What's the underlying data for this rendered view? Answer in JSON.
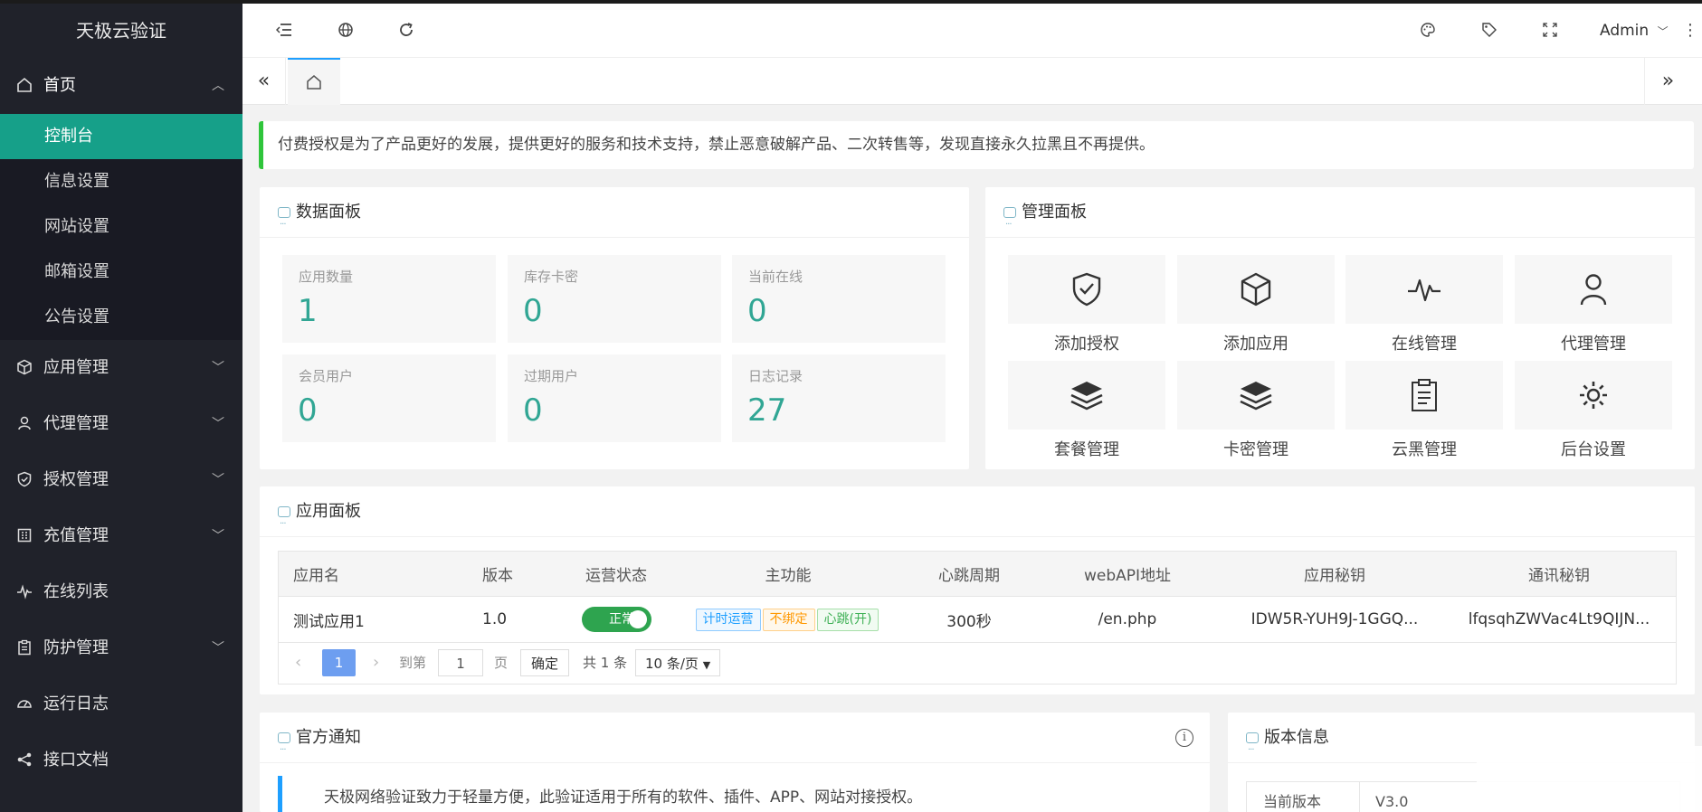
{
  "app": {
    "title": "天极云验证"
  },
  "sidebar": {
    "home": {
      "label": "首页",
      "children": [
        "控制台",
        "信息设置",
        "网站设置",
        "邮箱设置",
        "公告设置"
      ]
    },
    "items": [
      {
        "label": "应用管理",
        "icon": "cube-icon"
      },
      {
        "label": "代理管理",
        "icon": "user-icon"
      },
      {
        "label": "授权管理",
        "icon": "shield-icon"
      },
      {
        "label": "充值管理",
        "icon": "building-icon"
      },
      {
        "label": "在线列表",
        "icon": "pulse-icon"
      },
      {
        "label": "防护管理",
        "icon": "clipboard-icon"
      },
      {
        "label": "运行日志",
        "icon": "gauge-icon"
      },
      {
        "label": "接口文档",
        "icon": "share-icon"
      }
    ]
  },
  "header": {
    "user": "Admin"
  },
  "notice": "付费授权是为了产品更好的发展，提供更好的服务和技术支持，禁止恶意破解产品、二次转售等，发现直接永久拉黑且不再提供。",
  "data_panel": {
    "title": "数据面板",
    "stats": [
      {
        "label": "应用数量",
        "value": "1"
      },
      {
        "label": "库存卡密",
        "value": "0"
      },
      {
        "label": "当前在线",
        "value": "0"
      },
      {
        "label": "会员用户",
        "value": "0"
      },
      {
        "label": "过期用户",
        "value": "0"
      },
      {
        "label": "日志记录",
        "value": "27"
      }
    ]
  },
  "manage_panel": {
    "title": "管理面板",
    "tiles": [
      "添加授权",
      "添加应用",
      "在线管理",
      "代理管理",
      "套餐管理",
      "卡密管理",
      "云黑管理",
      "后台设置"
    ]
  },
  "app_panel": {
    "title": "应用面板",
    "columns": [
      "应用名",
      "版本",
      "运营状态",
      "主功能",
      "心跳周期",
      "webAPI地址",
      "应用秘钥",
      "通讯秘钥"
    ],
    "rows": [
      {
        "name": "测试应用1",
        "version": "1.0",
        "status": "正常",
        "tags": [
          "计时运营",
          "不绑定",
          "心跳(开)"
        ],
        "heartbeat": "300秒",
        "api": "/en.php",
        "app_key": "IDW5R-YUH9J-1GGQ...",
        "comm_key": "lfqsqhZWVac4Lt9QIJN..."
      }
    ],
    "pager": {
      "current": "1",
      "goto_label": "到第",
      "goto_value": "1",
      "page_unit": "页",
      "confirm": "确定",
      "total": "共 1 条",
      "size": "10 条/页"
    }
  },
  "official_notice": {
    "title": "官方通知",
    "text": "天极网络验证致力于轻量方便，此验证适用于所有的软件、插件、APP、网站对接授权。"
  },
  "version_info": {
    "title": "版本信息",
    "row_label": "当前版本",
    "row_value": "V3.0"
  }
}
